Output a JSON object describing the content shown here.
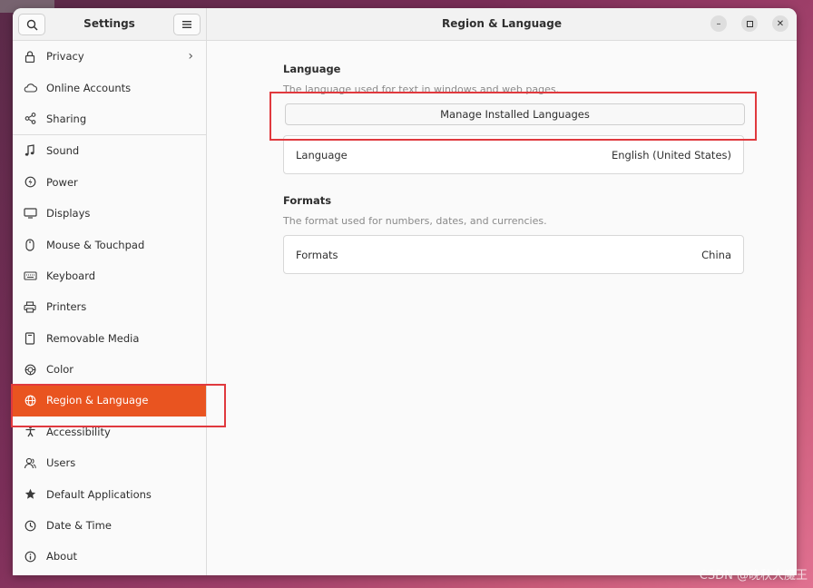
{
  "sidebar": {
    "title": "Settings",
    "items": [
      {
        "label": "Privacy",
        "icon": "lock-icon",
        "has_chevron": true
      },
      {
        "label": "Online Accounts",
        "icon": "cloud-icon"
      },
      {
        "label": "Sharing",
        "icon": "share-icon"
      },
      {
        "label": "Sound",
        "icon": "music-note-icon"
      },
      {
        "label": "Power",
        "icon": "power-icon"
      },
      {
        "label": "Displays",
        "icon": "display-icon"
      },
      {
        "label": "Mouse & Touchpad",
        "icon": "mouse-icon"
      },
      {
        "label": "Keyboard",
        "icon": "keyboard-icon"
      },
      {
        "label": "Printers",
        "icon": "printer-icon"
      },
      {
        "label": "Removable Media",
        "icon": "removable-media-icon"
      },
      {
        "label": "Color",
        "icon": "color-icon"
      },
      {
        "label": "Region & Language",
        "icon": "globe-icon",
        "active": true
      },
      {
        "label": "Accessibility",
        "icon": "accessibility-icon"
      },
      {
        "label": "Users",
        "icon": "users-icon"
      },
      {
        "label": "Default Applications",
        "icon": "star-icon"
      },
      {
        "label": "Date & Time",
        "icon": "clock-icon"
      },
      {
        "label": "About",
        "icon": "info-icon"
      }
    ]
  },
  "main": {
    "title": "Region & Language",
    "language_section": {
      "title": "Language",
      "subtitle": "The language used for text in windows and web pages.",
      "manage_button": "Manage Installed Languages",
      "row_label": "Language",
      "row_value": "English (United States)"
    },
    "formats_section": {
      "title": "Formats",
      "subtitle": "The format used for numbers, dates, and currencies.",
      "row_label": "Formats",
      "row_value": "China"
    }
  },
  "watermark": "CSDN @晚秋大魔王",
  "colors": {
    "accent": "#e95420",
    "highlight_box": "#e0393e"
  }
}
